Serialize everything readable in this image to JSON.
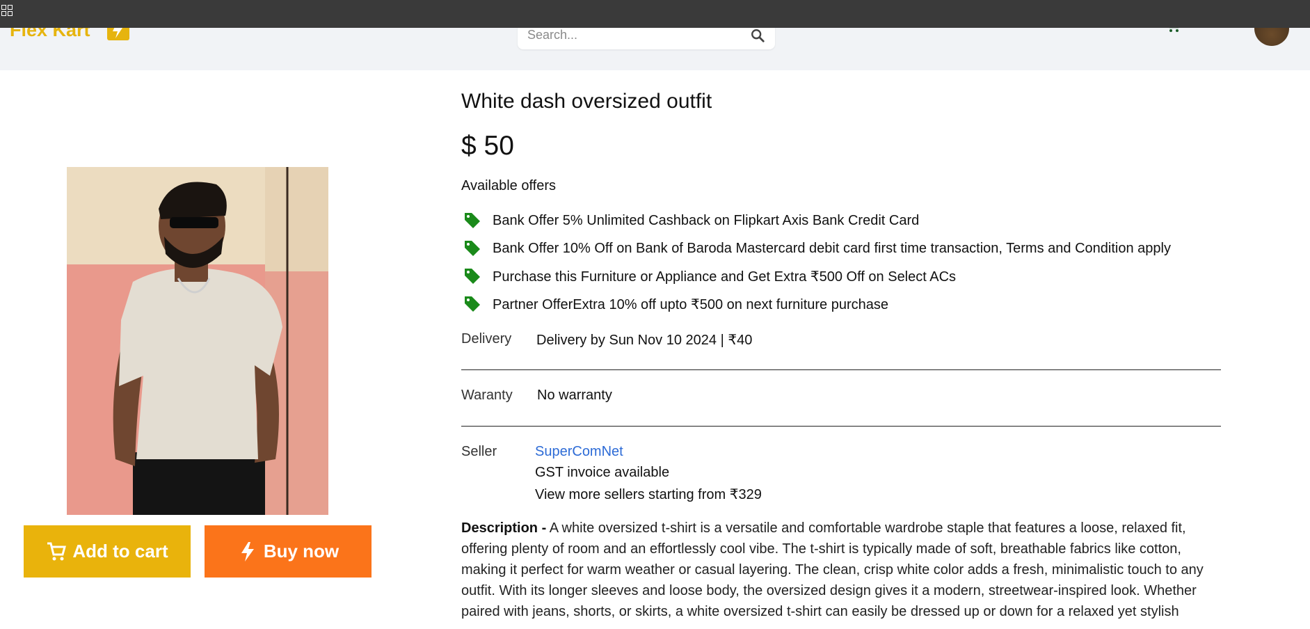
{
  "header": {
    "logo_text": "Flex Kart",
    "search_placeholder": "Search..."
  },
  "product": {
    "title": "White dash oversized outfit",
    "price": "$ 50",
    "offers_heading": "Available offers",
    "offers": [
      {
        "text": "Bank Offer 5% Unlimited Cashback on Flipkart Axis Bank Credit Card"
      },
      {
        "text": "Bank Offer 10% Off on Bank of Baroda Mastercard debit card first time transaction, Terms and Condition apply"
      },
      {
        "text": "Purchase this Furniture or Appliance and Get Extra ₹500 Off on Select ACs"
      },
      {
        "text": "Partner OfferExtra 10% off upto ₹500 on next furniture purchase"
      }
    ],
    "delivery": {
      "label": "Delivery",
      "value": "Delivery by Sun Nov 10 2024 | ₹40"
    },
    "warranty": {
      "label": "Waranty",
      "value": "No warranty"
    },
    "seller": {
      "label": "Seller",
      "name": "SuperComNet",
      "line2": "GST invoice available",
      "line3": "View more sellers starting from ₹329"
    },
    "description": {
      "label": "Description -",
      "text": "A white oversized t-shirt is a versatile and comfortable wardrobe staple that features a loose, relaxed fit, offering plenty of room and an effortlessly cool vibe. The t-shirt is typically made of soft, breathable fabrics like cotton, making it perfect for warm weather or casual layering. The clean, crisp white color adds a fresh, minimalistic touch to any outfit. With its longer sleeves and loose body, the oversized design gives it a modern, streetwear-inspired look. Whether paired with jeans, shorts, or skirts, a white oversized t-shirt can easily be dressed up or down for a relaxed yet stylish"
    }
  },
  "actions": {
    "add_to_cart": "Add to cart",
    "buy_now": "Buy now"
  },
  "colors": {
    "brand_yellow": "#e9b30c",
    "buy_orange": "#fb741a",
    "tag_green": "#1a8a1a",
    "seller_link": "#2d6bd6"
  },
  "icons": {
    "launcher": "apps-grid-icon",
    "search": "search-icon",
    "cart": "cart-icon",
    "offer_tag": "tag-icon",
    "buy": "lightning-icon"
  }
}
